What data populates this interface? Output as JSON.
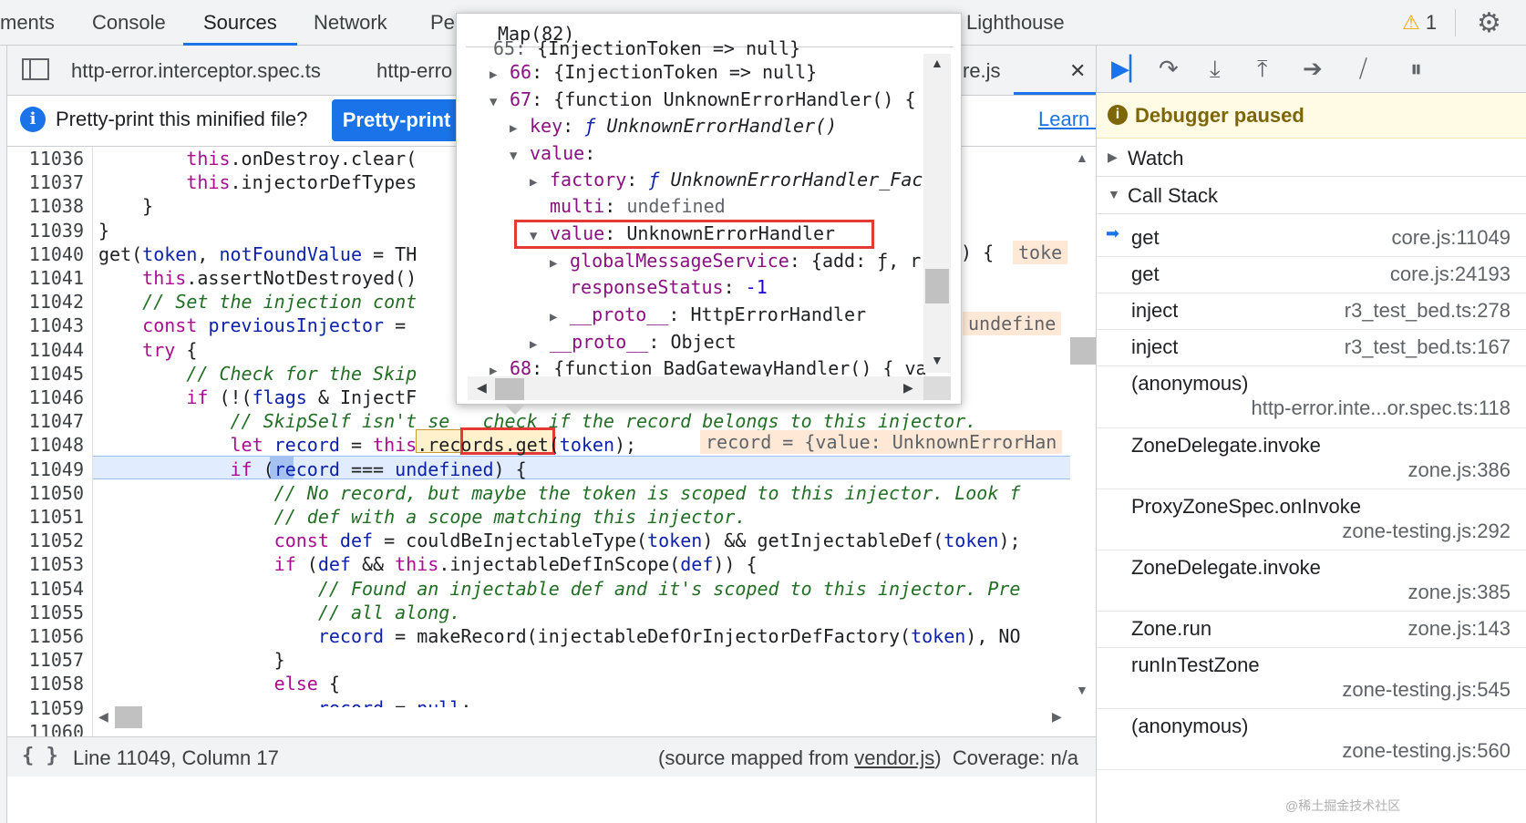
{
  "tabs": [
    "ments",
    "Console",
    "Sources",
    "Network",
    "Pe",
    "Lighthouse"
  ],
  "warnings_count": "1",
  "file_tabs": [
    "http-error.interceptor.spec.ts",
    "http-erro",
    "re.js"
  ],
  "pretty_print": {
    "message": "Pretty-print this minified file?",
    "button": "Pretty-print",
    "learn_more": "Learn more"
  },
  "editor": {
    "lines": [
      {
        "n": "11036",
        "code": "        this.onDestroy.clear("
      },
      {
        "n": "11037",
        "code": "        this.injectorDefTypes"
      },
      {
        "n": "11038",
        "code": "    }"
      },
      {
        "n": "11039",
        "code": "}"
      },
      {
        "n": "11040",
        "code": "get(token, notFoundValue = TH"
      },
      {
        "n": "11041",
        "code": "    this.assertNotDestroyed()"
      },
      {
        "n": "11042",
        "code": "    // Set the injection cont"
      },
      {
        "n": "11043",
        "code": "    const previousInjector ="
      },
      {
        "n": "11044",
        "code": "    try {"
      },
      {
        "n": "11045",
        "code": "        // Check for the Skip"
      },
      {
        "n": "11046",
        "code": "        if (!(flags & InjectF"
      },
      {
        "n": "11047",
        "code": "            // SkipSelf isn't se   check if the record belongs to this injector."
      },
      {
        "n": "11048",
        "code": "            let record = this.records.get(token);"
      },
      {
        "n": "11049",
        "code": "            if (record === undefined) {"
      },
      {
        "n": "11050",
        "code": "                // No record, but maybe the token is scoped to this injector. Look f"
      },
      {
        "n": "11051",
        "code": "                // def with a scope matching this injector."
      },
      {
        "n": "11052",
        "code": "                const def = couldBeInjectableType(token) && getInjectableDef(token);"
      },
      {
        "n": "11053",
        "code": "                if (def && this.injectableDefInScope(def)) {"
      },
      {
        "n": "11054",
        "code": "                    // Found an injectable def and it's scoped to this injector. Pre"
      },
      {
        "n": "11055",
        "code": "                    // all along."
      },
      {
        "n": "11056",
        "code": "                    record = makeRecord(injectableDefOrInjectorDefFactory(token), NO"
      },
      {
        "n": "11057",
        "code": "                }"
      },
      {
        "n": "11058",
        "code": "                else {"
      },
      {
        "n": "11059",
        "code": "                    record = null;"
      },
      {
        "n": "11060",
        "code": ""
      }
    ],
    "inline_values": {
      "l11040": ") {",
      "l11040_tag": "toke",
      "l11043": "undefine",
      "l11048": "record = {value: UnknownErrorHan"
    }
  },
  "status": {
    "position": "Line 11049, Column 17",
    "source_prefix": "(source mapped from ",
    "source_file": "vendor.js",
    "source_suffix": ")",
    "coverage": "Coverage: n/a"
  },
  "debugger": {
    "paused": "Debugger paused",
    "watch": "Watch",
    "call_stack": "Call Stack",
    "frames": [
      {
        "name": "get",
        "loc": "core.js:11049"
      },
      {
        "name": "get",
        "loc": "core.js:24193"
      },
      {
        "name": "inject",
        "loc": "r3_test_bed.ts:278"
      },
      {
        "name": "inject",
        "loc": "r3_test_bed.ts:167"
      },
      {
        "name": "(anonymous)",
        "loc": "http-error.inte...or.spec.ts:118"
      },
      {
        "name": "ZoneDelegate.invoke",
        "loc": "zone.js:386"
      },
      {
        "name": "ProxyZoneSpec.onInvoke",
        "loc": "zone-testing.js:292"
      },
      {
        "name": "ZoneDelegate.invoke",
        "loc": "zone.js:385"
      },
      {
        "name": "Zone.run",
        "loc": "zone.js:143"
      },
      {
        "name": "runInTestZone",
        "loc": "zone-testing.js:545"
      },
      {
        "name": "(anonymous)",
        "loc": "zone-testing.js:560"
      }
    ]
  },
  "popover": {
    "title": "Map(82)",
    "rows": {
      "r0": "{InjectionToken => null}",
      "r1_key": "66",
      "r1_val": "{InjectionToken => null}",
      "r2_key": "67",
      "r2_val": "{function UnknownErrorHandler() {",
      "r3_key": "key",
      "r3_val": "UnknownErrorHandler()",
      "r4_key": "value",
      "r5_key": "factory",
      "r5_val": "UnknownErrorHandler_Fac",
      "r6_key": "multi",
      "r6_val": "undefined",
      "r7_key": "value",
      "r7_val": "UnknownErrorHandler",
      "r8_key": "globalMessageService",
      "r8_val": "{add: ƒ, r",
      "r9_key": "responseStatus",
      "r9_val": "-1",
      "r10_key": "__proto__",
      "r10_val": "HttpErrorHandler",
      "r11_key": "__proto__",
      "r11_val": "Object",
      "r12_key": "68",
      "r12_val": "{function BadGatewayHandler() { va"
    }
  },
  "watermark": "@稀土掘金技术社区"
}
